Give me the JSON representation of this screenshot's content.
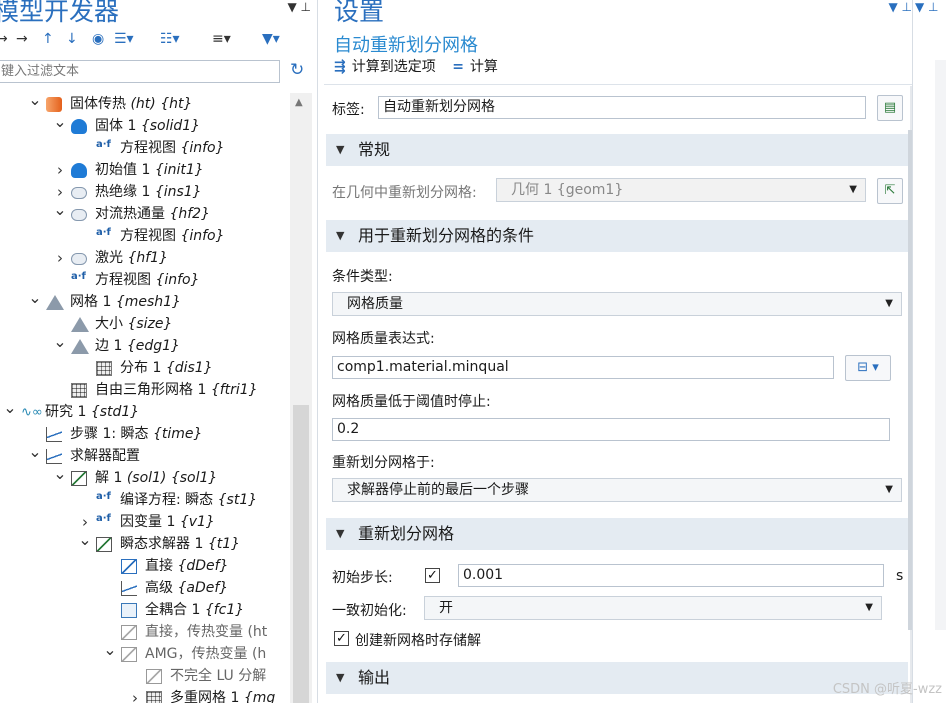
{
  "left_panel": {
    "title": "模型开发器",
    "filter_placeholder": "键入过滤文本",
    "tree": [
      {
        "label": "固体传热",
        "tag": "(ht) {ht}",
        "level": 2,
        "arrow": "down",
        "icon": "heat-transfer-icon"
      },
      {
        "label": "固体 1",
        "tag": "{solid1}",
        "level": 3,
        "arrow": "down",
        "icon": "domain-icon"
      },
      {
        "label": "方程视图",
        "tag": "{info}",
        "level": 4,
        "arrow": "",
        "icon": "equation-view-icon"
      },
      {
        "label": "初始值 1",
        "tag": "{init1}",
        "level": 3,
        "arrow": "right",
        "icon": "domain-icon"
      },
      {
        "label": "热绝缘 1",
        "tag": "{ins1}",
        "level": 3,
        "arrow": "right",
        "icon": "boundary-icon"
      },
      {
        "label": "对流热通量",
        "tag": "{hf2}",
        "level": 3,
        "arrow": "down",
        "icon": "boundary-icon"
      },
      {
        "label": "方程视图",
        "tag": "{info}",
        "level": 4,
        "arrow": "",
        "icon": "equation-view-icon"
      },
      {
        "label": "激光",
        "tag": "{hf1}",
        "level": 3,
        "arrow": "right",
        "icon": "boundary-icon"
      },
      {
        "label": "方程视图",
        "tag": "{info}",
        "level": 3,
        "arrow": "",
        "icon": "equation-view-icon"
      },
      {
        "label": "网格 1",
        "tag": "{mesh1}",
        "level": 2,
        "arrow": "down",
        "icon": "mesh-icon"
      },
      {
        "label": "大小",
        "tag": "{size}",
        "level": 3,
        "arrow": "",
        "icon": "mesh-size-icon"
      },
      {
        "label": "边 1",
        "tag": "{edg1}",
        "level": 3,
        "arrow": "down",
        "icon": "edge-icon"
      },
      {
        "label": "分布 1",
        "tag": "{dis1}",
        "level": 4,
        "arrow": "",
        "icon": "distribution-icon"
      },
      {
        "label": "自由三角形网格 1",
        "tag": "{ftri1}",
        "level": 3,
        "arrow": "",
        "icon": "free-triangular-icon"
      },
      {
        "label": "研究 1",
        "tag": "{std1}",
        "level": 1,
        "arrow": "down",
        "icon": "study-icon"
      },
      {
        "label": "步骤 1: 瞬态",
        "tag": "{time}",
        "level": 2,
        "arrow": "",
        "icon": "time-step-icon"
      },
      {
        "label": "求解器配置",
        "tag": "",
        "level": 2,
        "arrow": "down",
        "icon": "solver-config-icon"
      },
      {
        "label": "解 1",
        "tag": "(sol1) {sol1}",
        "level": 3,
        "arrow": "down",
        "icon": "solution-icon"
      },
      {
        "label": "编译方程: 瞬态",
        "tag": "{st1}",
        "level": 4,
        "arrow": "",
        "icon": "equation-view-icon"
      },
      {
        "label": "因变量 1",
        "tag": "{v1}",
        "level": 4,
        "arrow": "right",
        "icon": "dependent-variables-icon"
      },
      {
        "label": "瞬态求解器 1",
        "tag": "{t1}",
        "level": 4,
        "arrow": "down",
        "icon": "time-solver-icon"
      },
      {
        "label": "直接",
        "tag": "{dDef}",
        "level": 5,
        "arrow": "",
        "icon": "direct-icon"
      },
      {
        "label": "高级",
        "tag": "{aDef}",
        "level": 5,
        "arrow": "",
        "icon": "advanced-icon"
      },
      {
        "label": "全耦合 1",
        "tag": "{fc1}",
        "level": 5,
        "arrow": "",
        "icon": "fully-coupled-icon"
      },
      {
        "label": "直接，传热变量 (ht",
        "tag": "",
        "level": 5,
        "arrow": "",
        "icon": "direct-disabled-icon",
        "dim": true
      },
      {
        "label": "AMG，传热变量 (h",
        "tag": "",
        "level": 5,
        "arrow": "down",
        "icon": "amg-disabled-icon",
        "dim": true
      },
      {
        "label": "不完全 LU 分解",
        "tag": "",
        "level": 6,
        "arrow": "",
        "icon": "ilu-disabled-icon",
        "dim": true
      },
      {
        "label": "多重网格 1",
        "tag": "{mg",
        "level": 6,
        "arrow": "right",
        "icon": "multigrid-icon",
        "dim": false
      }
    ]
  },
  "right_panel": {
    "title": "设置",
    "subtitle": "自动重新划分网格",
    "compute_to_selected": "计算到选定项",
    "compute": "计算",
    "label_caption": "标签:",
    "label_value": "自动重新划分网格",
    "sections": {
      "general": "常规",
      "conditions": "用于重新划分网格的条件",
      "remesh": "重新划分网格",
      "output": "输出"
    },
    "remesh_in_geometry_caption": "在几何中重新划分网格:",
    "remesh_in_geometry_value": "几何 1 {geom1}",
    "condition_type_caption": "条件类型:",
    "condition_type_value": "网格质量",
    "mesh_quality_expr_caption": "网格质量表达式:",
    "mesh_quality_expr_value": "comp1.material.minqual",
    "stop_below_caption": "网格质量低于阈值时停止:",
    "stop_below_value": "0.2",
    "remesh_at_caption": "重新划分网格于:",
    "remesh_at_value": "求解器停止前的最后一个步骤",
    "initial_step_caption": "初始步长:",
    "initial_step_value": "0.001",
    "initial_step_unit": "s",
    "consistent_init_caption": "一致初始化:",
    "consistent_init_value": "开",
    "store_solution_caption": "创建新网格时存储解",
    "initial_step_checked": true,
    "store_solution_checked": true
  },
  "watermark": "CSDN @听夏-wzz"
}
